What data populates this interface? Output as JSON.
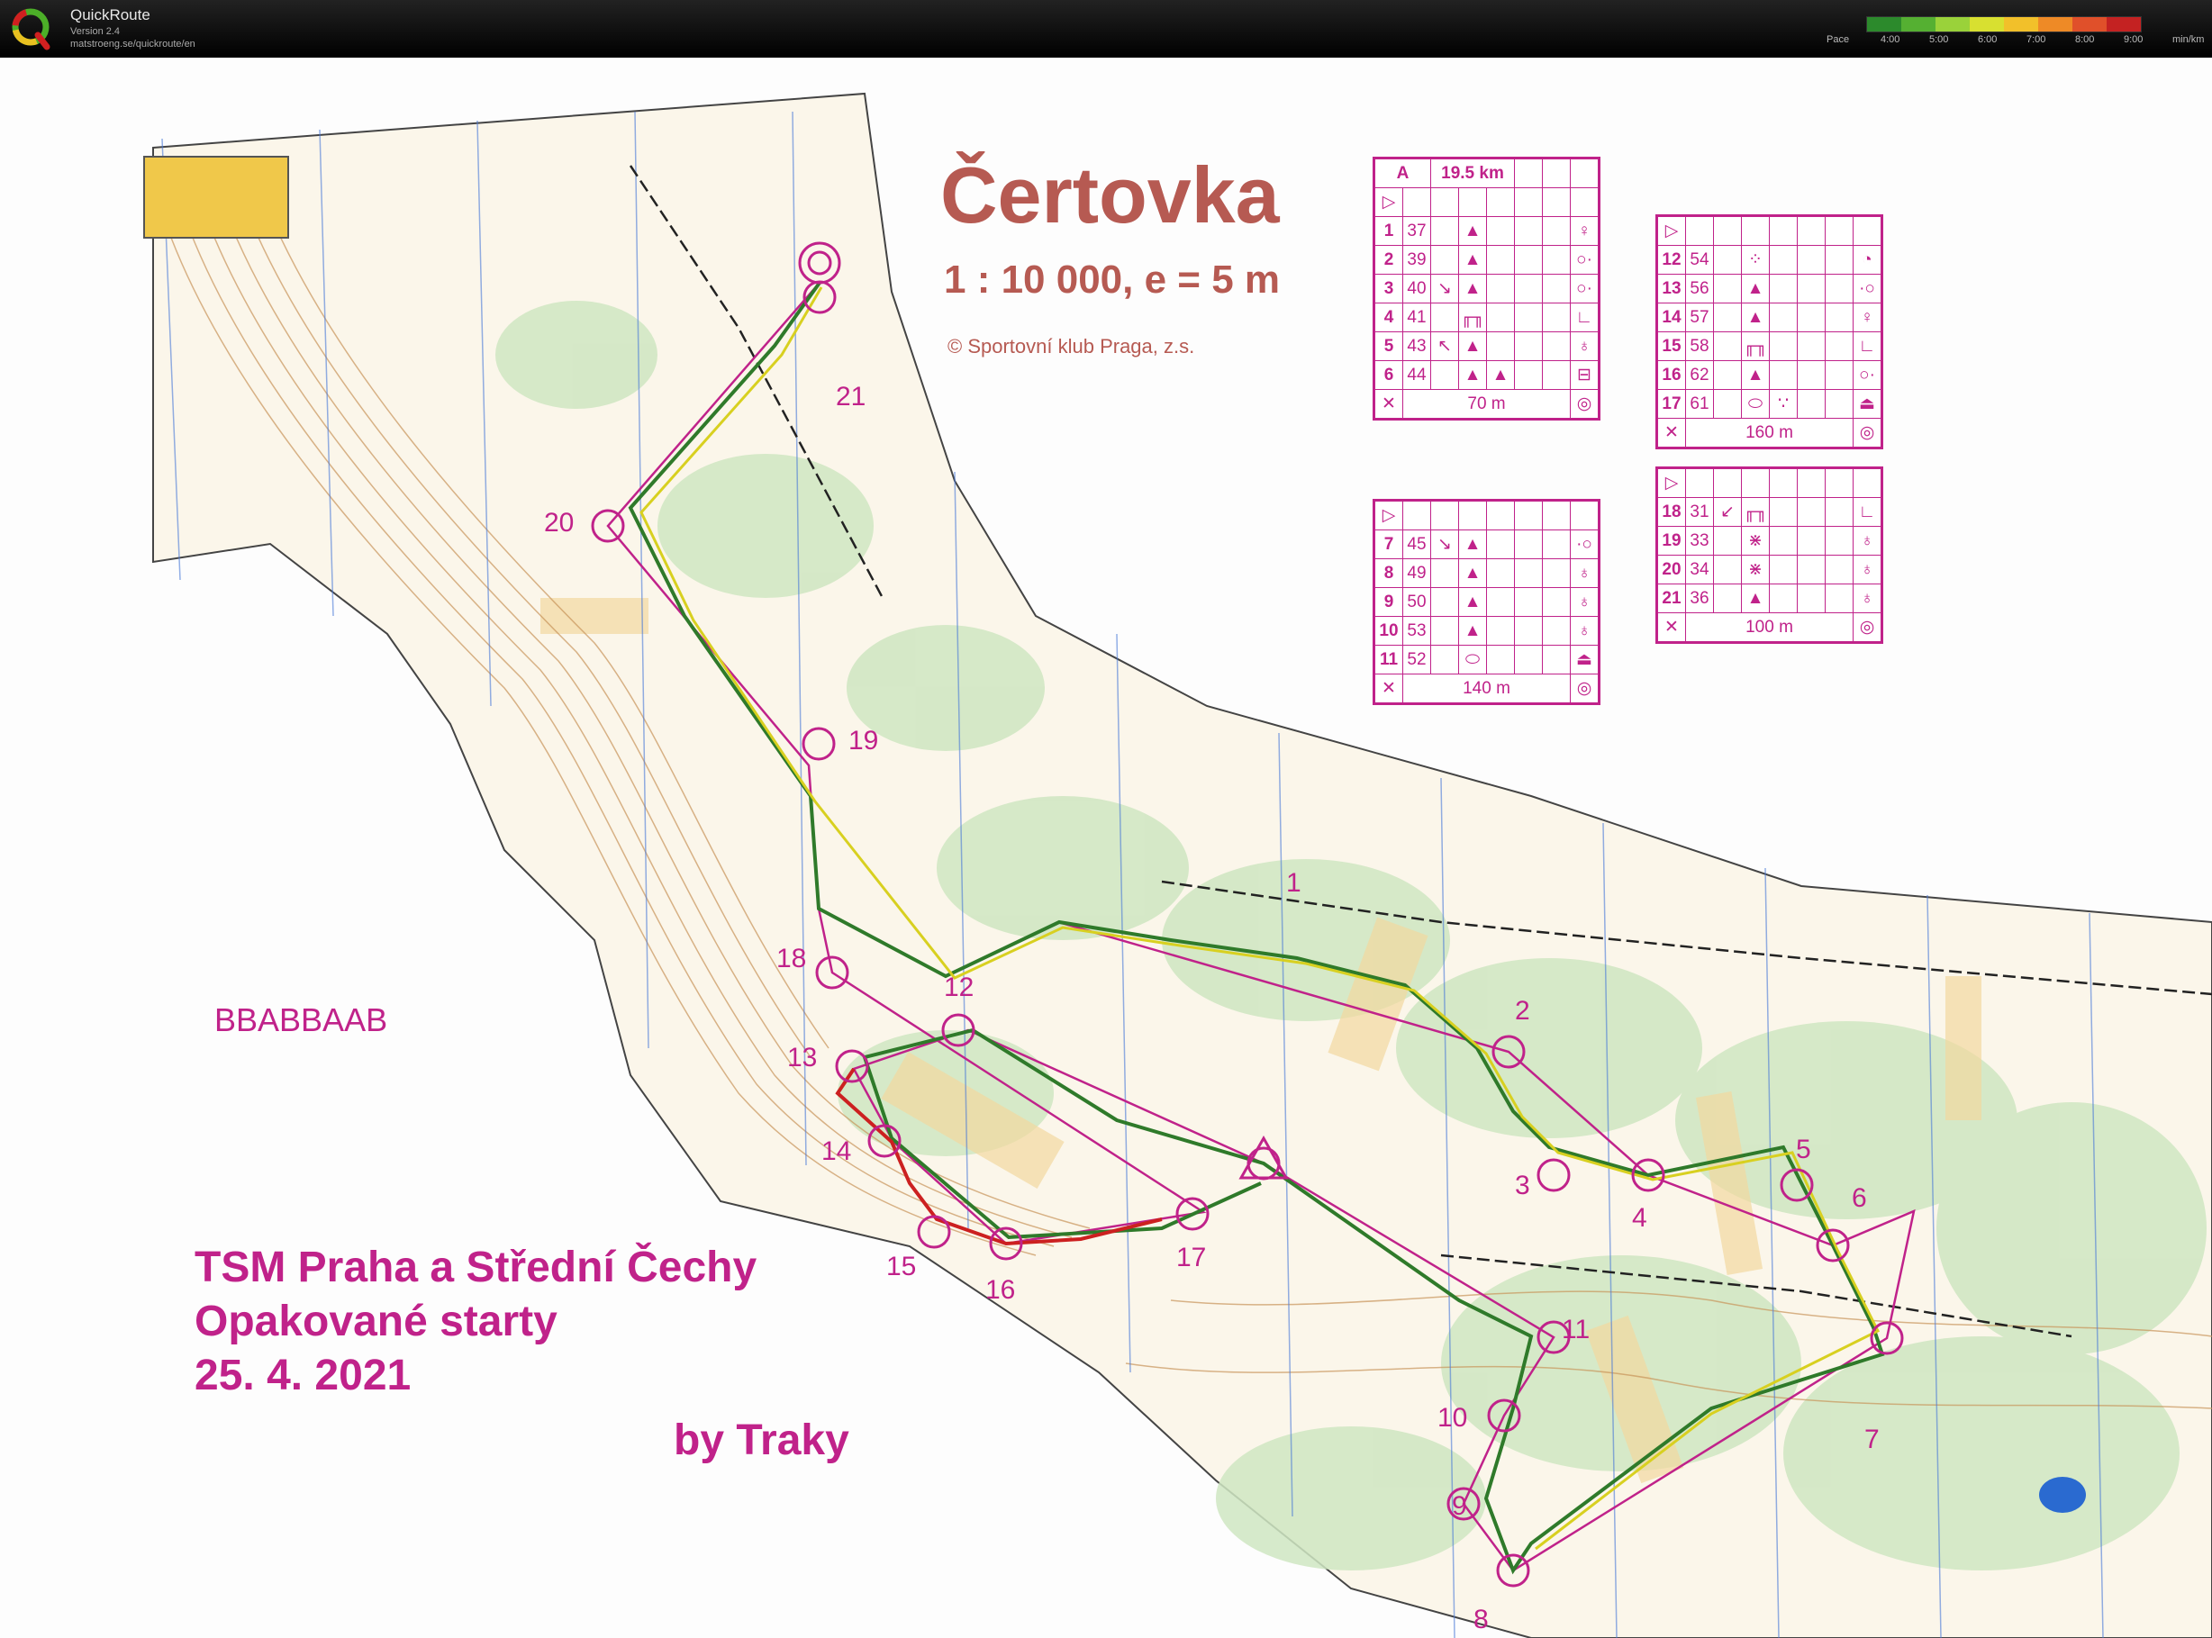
{
  "app": {
    "name": "QuickRoute",
    "version": "Version 2.4",
    "url": "matstroeng.se/quickroute/en",
    "logo_letter": "Q"
  },
  "pace_legend": {
    "label": "Pace",
    "ticks": [
      "4:00",
      "5:00",
      "6:00",
      "7:00",
      "8:00",
      "9:00"
    ],
    "unit": "min/km",
    "colors": [
      "#2c8a2c",
      "#55b032",
      "#9ad23a",
      "#d8e030",
      "#f2c02a",
      "#ee8a26",
      "#e0502a",
      "#c42222"
    ]
  },
  "map": {
    "title": "Čertovka",
    "scale": "1 : 10 000, e = 5 m",
    "copyright": "© Sportovní klub Praga, z.s.",
    "course_code": "BBABBAAB",
    "event_line1": "TSM Praha a Střední Čechy",
    "event_line2": "Opakované starty",
    "event_line3": "25. 4. 2021",
    "author": "by Traky",
    "colors": {
      "course": "#c0228a",
      "route_green": "#2f7a2a",
      "route_yellow": "#d8d020",
      "route_red": "#cc2020",
      "vegetation": "#cfe6c2",
      "open_land": "#f2d9a0",
      "contour": "#c8945a",
      "magnetic_line": "#4a7ad8"
    },
    "controls": [
      {
        "label": "1"
      },
      {
        "label": "2"
      },
      {
        "label": "3"
      },
      {
        "label": "4"
      },
      {
        "label": "5"
      },
      {
        "label": "6"
      },
      {
        "label": "7"
      },
      {
        "label": "8"
      },
      {
        "label": "9"
      },
      {
        "label": "10"
      },
      {
        "label": "11"
      },
      {
        "label": "12"
      },
      {
        "label": "13"
      },
      {
        "label": "14"
      },
      {
        "label": "15"
      },
      {
        "label": "16"
      },
      {
        "label": "17"
      },
      {
        "label": "18"
      },
      {
        "label": "19"
      },
      {
        "label": "20"
      },
      {
        "label": "21"
      }
    ]
  },
  "descriptions": {
    "course": "A",
    "length": "19.5 km",
    "block1": [
      {
        "n": "1",
        "code": "37",
        "c": "",
        "d": "▲",
        "e": "",
        "f": "",
        "g": "",
        "h": "♀"
      },
      {
        "n": "2",
        "code": "39",
        "c": "",
        "d": "▲",
        "e": "",
        "f": "",
        "g": "",
        "h": "○·"
      },
      {
        "n": "3",
        "code": "40",
        "c": "↘",
        "d": "▲",
        "e": "",
        "f": "",
        "g": "",
        "h": "○·"
      },
      {
        "n": "4",
        "code": "41",
        "c": "",
        "d": "╓╖",
        "e": "",
        "f": "",
        "g": "",
        "h": "∟"
      },
      {
        "n": "5",
        "code": "43",
        "c": "↖",
        "d": "▲",
        "e": "",
        "f": "",
        "g": "",
        "h": "♁"
      },
      {
        "n": "6",
        "code": "44",
        "c": "",
        "d": "▲",
        "e": "▲",
        "f": "",
        "g": "",
        "h": "⊟"
      }
    ],
    "block1_end": "70 m",
    "block2": [
      {
        "n": "7",
        "code": "45",
        "c": "↘",
        "d": "▲",
        "e": "",
        "f": "",
        "g": "",
        "h": "·○"
      },
      {
        "n": "8",
        "code": "49",
        "c": "",
        "d": "▲",
        "e": "",
        "f": "",
        "g": "",
        "h": "♁"
      },
      {
        "n": "9",
        "code": "50",
        "c": "",
        "d": "▲",
        "e": "",
        "f": "",
        "g": "",
        "h": "♁"
      },
      {
        "n": "10",
        "code": "53",
        "c": "",
        "d": "▲",
        "e": "",
        "f": "",
        "g": "",
        "h": "♁"
      },
      {
        "n": "11",
        "code": "52",
        "c": "",
        "d": "⬭",
        "e": "",
        "f": "",
        "g": "",
        "h": "⏏"
      }
    ],
    "block2_end": "140 m",
    "block3": [
      {
        "n": "12",
        "code": "54",
        "c": "",
        "d": "⁘",
        "e": "",
        "f": "",
        "g": "",
        "h": "◔"
      },
      {
        "n": "13",
        "code": "56",
        "c": "",
        "d": "▲",
        "e": "",
        "f": "",
        "g": "",
        "h": "·○"
      },
      {
        "n": "14",
        "code": "57",
        "c": "",
        "d": "▲",
        "e": "",
        "f": "",
        "g": "",
        "h": "♀"
      },
      {
        "n": "15",
        "code": "58",
        "c": "",
        "d": "╓╖",
        "e": "",
        "f": "",
        "g": "",
        "h": "∟"
      },
      {
        "n": "16",
        "code": "62",
        "c": "",
        "d": "▲",
        "e": "",
        "f": "",
        "g": "",
        "h": "○·"
      },
      {
        "n": "17",
        "code": "61",
        "c": "",
        "d": "⬭",
        "e": "∵",
        "f": "",
        "g": "",
        "h": "⏏"
      }
    ],
    "block3_end": "160 m",
    "block4": [
      {
        "n": "18",
        "code": "31",
        "c": "↙",
        "d": "╓╖",
        "e": "",
        "f": "",
        "g": "",
        "h": "∟"
      },
      {
        "n": "19",
        "code": "33",
        "c": "",
        "d": "⋇",
        "e": "",
        "f": "",
        "g": "",
        "h": "♁"
      },
      {
        "n": "20",
        "code": "34",
        "c": "",
        "d": "⋇",
        "e": "",
        "f": "",
        "g": "",
        "h": "♁"
      },
      {
        "n": "21",
        "code": "36",
        "c": "",
        "d": "▲",
        "e": "",
        "f": "",
        "g": "",
        "h": "♁"
      }
    ],
    "block4_end": "100 m",
    "start_symbol": "▷",
    "finish_symbol": "◎"
  }
}
